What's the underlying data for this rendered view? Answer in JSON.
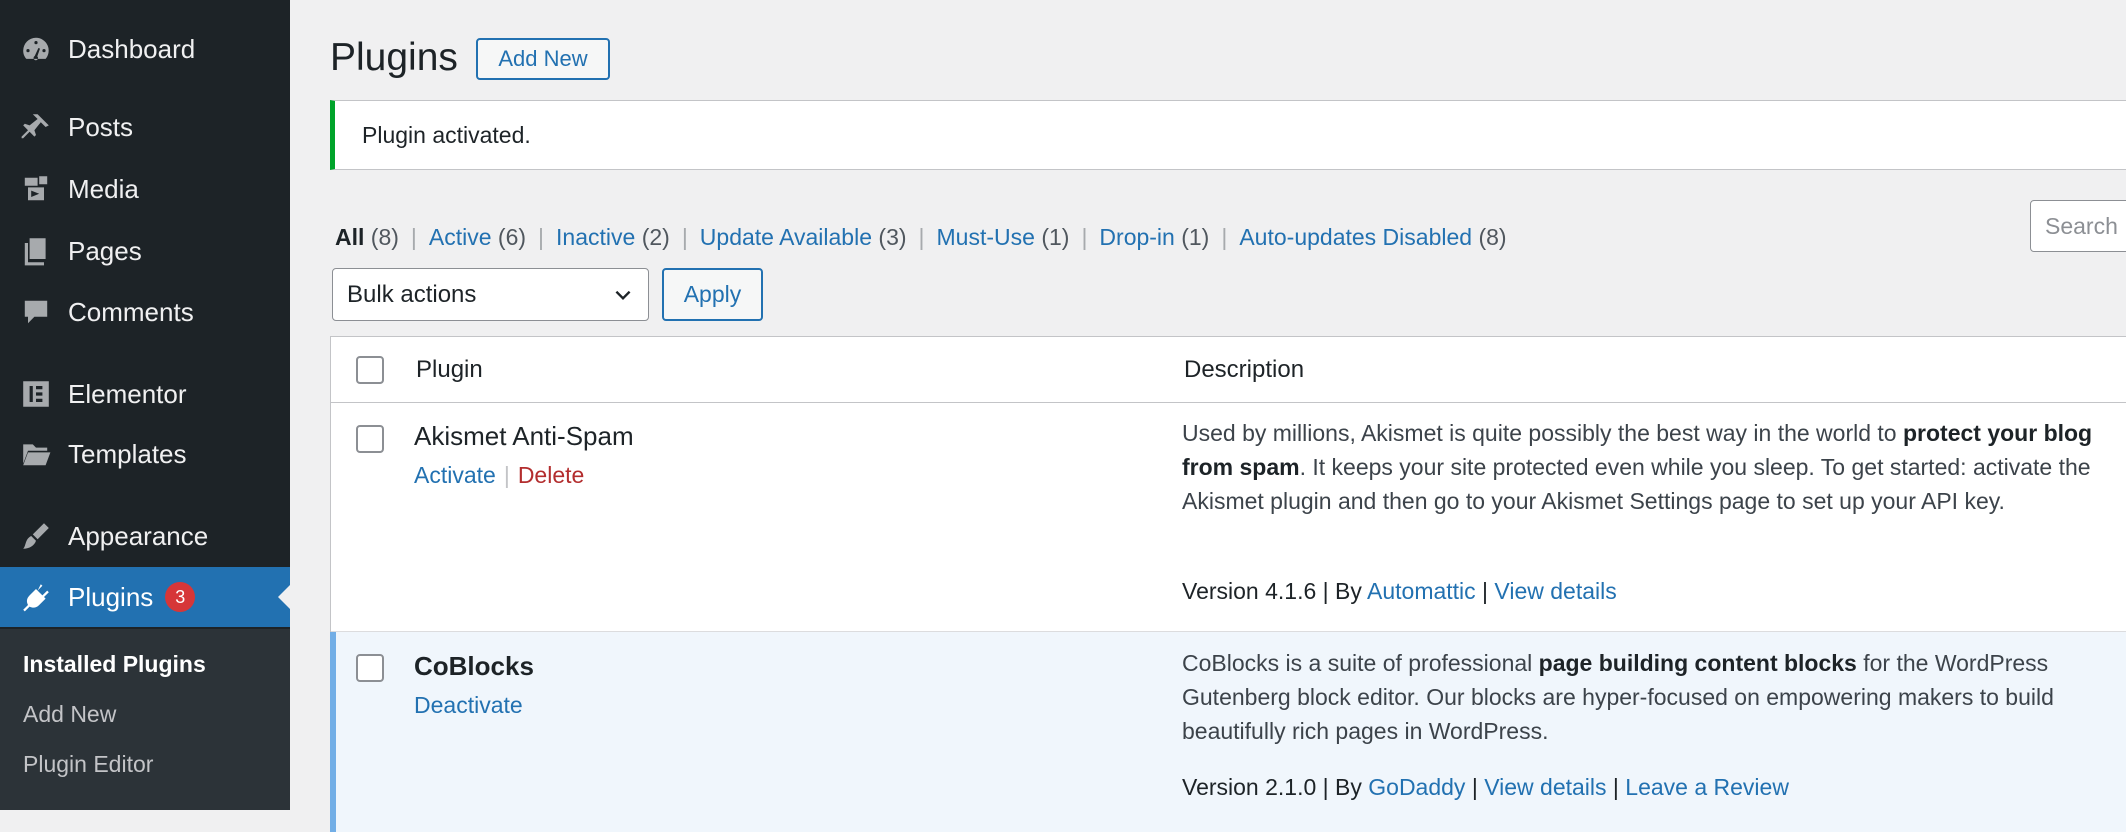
{
  "sidebar": {
    "items": [
      {
        "label": "Dashboard",
        "icon": "dashboard-icon"
      },
      {
        "label": "Posts",
        "icon": "pin-icon"
      },
      {
        "label": "Media",
        "icon": "media-icon"
      },
      {
        "label": "Pages",
        "icon": "pages-icon"
      },
      {
        "label": "Comments",
        "icon": "comment-icon"
      },
      {
        "label": "Elementor",
        "icon": "elementor-icon"
      },
      {
        "label": "Templates",
        "icon": "folder-icon"
      },
      {
        "label": "Appearance",
        "icon": "brush-icon"
      },
      {
        "label": "Plugins",
        "icon": "plugin-icon",
        "badge": "3"
      }
    ],
    "submenu": [
      "Installed Plugins",
      "Add New",
      "Plugin Editor"
    ]
  },
  "header": {
    "title": "Plugins",
    "add_new": "Add New"
  },
  "notice": "Plugin activated.",
  "filters": [
    {
      "label": "All",
      "count": "(8)"
    },
    {
      "label": "Active",
      "count": "(6)"
    },
    {
      "label": "Inactive",
      "count": "(2)"
    },
    {
      "label": "Update Available",
      "count": "(3)"
    },
    {
      "label": "Must-Use",
      "count": "(1)"
    },
    {
      "label": "Drop-in",
      "count": "(1)"
    },
    {
      "label": "Auto-updates Disabled",
      "count": "(8)"
    }
  ],
  "search_placeholder": "Search",
  "bulk": {
    "selected": "Bulk actions",
    "apply": "Apply"
  },
  "table": {
    "columns": [
      "Plugin",
      "Description"
    ],
    "rows": [
      {
        "name": "Akismet Anti-Spam",
        "actions": [
          "Activate",
          "Delete"
        ],
        "desc_1": "Used by millions, Akismet is quite possibly the best way in the world to ",
        "desc_bold": "protect your blog from spam",
        "desc_2": ". It keeps your site protected even while you sleep. To get started: activate the Akismet plugin and then go to your Akismet Settings page to set up your API key.",
        "version": "Version 4.1.6",
        "by": "By",
        "author": "Automattic",
        "details": "View details"
      },
      {
        "name": "CoBlocks",
        "actions": [
          "Deactivate"
        ],
        "desc_1": "CoBlocks is a suite of professional ",
        "desc_bold": "page building content blocks",
        "desc_2": " for the WordPress Gutenberg block editor. Our blocks are hyper-focused on empowering makers to build beautifully rich pages in WordPress.",
        "version": "Version 2.1.0",
        "by": "By",
        "author": "GoDaddy",
        "details": "View details",
        "review": "Leave a Review"
      }
    ]
  },
  "colors": {
    "sidebar_bg": "#1d2327",
    "accent": "#2271b1",
    "notice_success": "#00a32a",
    "badge": "#d63638",
    "delete": "#b32d2e"
  }
}
